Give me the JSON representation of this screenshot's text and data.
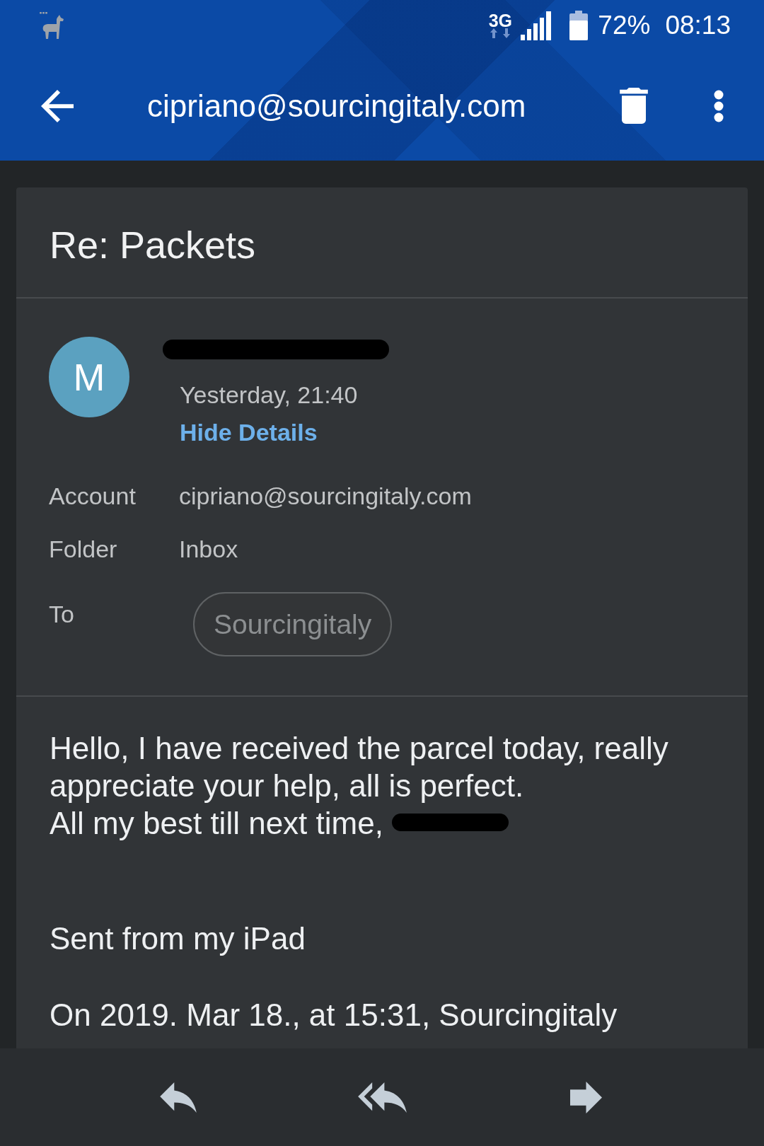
{
  "status_bar": {
    "network": "3G",
    "battery": "72%",
    "time": "08:13"
  },
  "toolbar": {
    "title": "cipriano@sourcingitaly.com"
  },
  "message": {
    "subject": "Re: Packets",
    "sender": {
      "initial": "M",
      "name_redacted": true
    },
    "date": "Yesterday, 21:40",
    "details_toggle": "Hide Details",
    "details": [
      {
        "label": "Account",
        "value": "cipriano@sourcingitaly.com",
        "kind": "text"
      },
      {
        "label": "Folder",
        "value": "Inbox",
        "kind": "text"
      },
      {
        "label": "To",
        "value": "Sourcingitaly",
        "kind": "chip"
      }
    ],
    "body": {
      "text_lines": [
        "Hello, I have received the parcel today, really appreciate your help, all is perfect.",
        "All my best till next time,"
      ],
      "signature_redacted": true,
      "device_signature": "Sent from my iPad",
      "quote_header": "On 2019. Mar 18., at 15:31, Sourcingitaly"
    }
  }
}
